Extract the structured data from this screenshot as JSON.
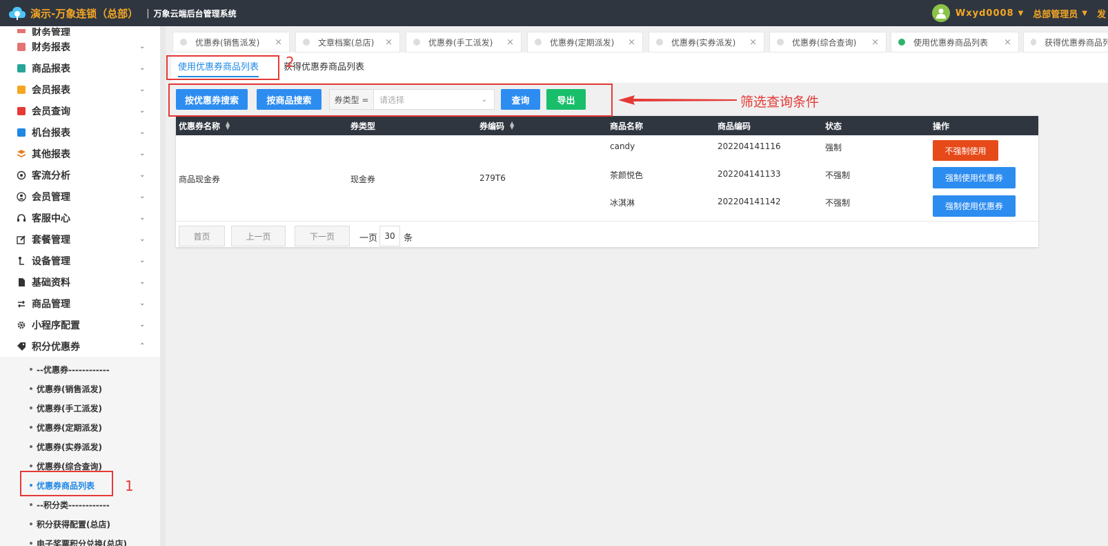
{
  "header": {
    "brand": "演示-万象连锁（总部）",
    "separator": "|",
    "system_name": "万象云端后台管理系统",
    "username": "Wxyd0008",
    "role": "总部管理员",
    "extra": "发"
  },
  "sidebar": {
    "first_partial": "财务管理",
    "items": [
      {
        "label": "财务报表",
        "icon": "finance-report-icon",
        "color": "#e57373"
      },
      {
        "label": "商品报表",
        "icon": "product-report-icon",
        "color": "#26a69a"
      },
      {
        "label": "会员报表",
        "icon": "member-report-icon",
        "color": "#f5a623"
      },
      {
        "label": "会员查询",
        "icon": "member-query-icon",
        "color": "#e53935"
      },
      {
        "label": "机台报表",
        "icon": "machine-report-icon",
        "color": "#1e88e5"
      },
      {
        "label": "其他报表",
        "icon": "layers-icon",
        "color": "#e67e22"
      },
      {
        "label": "客流分析",
        "icon": "target-icon",
        "color": "#333333"
      },
      {
        "label": "会员管理",
        "icon": "user-icon",
        "color": "#333333"
      },
      {
        "label": "客服中心",
        "icon": "headset-icon",
        "color": "#333333"
      },
      {
        "label": "套餐管理",
        "icon": "edit-icon",
        "color": "#333333"
      },
      {
        "label": "设备管理",
        "icon": "joystick-icon",
        "color": "#333333"
      },
      {
        "label": "基础资料",
        "icon": "file-icon",
        "color": "#333333"
      },
      {
        "label": "商品管理",
        "icon": "swap-icon",
        "color": "#333333"
      },
      {
        "label": "小程序配置",
        "icon": "gear-icon",
        "color": "#333333"
      },
      {
        "label": "积分优惠券",
        "icon": "tag-icon",
        "color": "#333333"
      }
    ],
    "submenu": [
      {
        "label": "--优惠券------------",
        "divider": true
      },
      {
        "label": "优惠券(销售派发)"
      },
      {
        "label": "优惠券(手工派发)"
      },
      {
        "label": "优惠券(定期派发)"
      },
      {
        "label": "优惠券(实券派发)"
      },
      {
        "label": "优惠券(综合查询)"
      },
      {
        "label": "优惠券商品列表",
        "active": true
      },
      {
        "label": "--积分类------------",
        "divider": true
      },
      {
        "label": "积分获得配置(总店)"
      },
      {
        "label": "电子奖票积分兑换(总店)"
      }
    ]
  },
  "tabs": [
    {
      "label": "优惠券(销售派发)",
      "close": "×"
    },
    {
      "label": "文章档案(总店)",
      "close": "×"
    },
    {
      "label": "优惠券(手工派发)",
      "close": "×"
    },
    {
      "label": "优惠券(定期派发)",
      "close": "×"
    },
    {
      "label": "优惠券(实券派发)",
      "close": "×"
    },
    {
      "label": "优惠券(综合查询)",
      "close": "×"
    },
    {
      "label": "使用优惠券商品列表",
      "close": "×",
      "active": true
    },
    {
      "label": "获得优惠券商品列表",
      "close": "×"
    }
  ],
  "subtabs": [
    {
      "label": "使用优惠券商品列表",
      "active": true
    },
    {
      "label": "获得优惠券商品列表",
      "active": false
    }
  ],
  "filter": {
    "search_by_coupon": "按优惠券搜索",
    "search_by_product": "按商品搜索",
    "type_prefix": "券类型 =",
    "type_placeholder": "请选择",
    "query": "查询",
    "export": "导出"
  },
  "table": {
    "columns": [
      "优惠券名称",
      "券类型",
      "券编码",
      "商品名称",
      "商品编码",
      "状态",
      "操作"
    ],
    "group": {
      "coupon_name": "商品现金券",
      "coupon_type": "现金券",
      "coupon_code": "279T6"
    },
    "rows": [
      {
        "product_name": "candy",
        "product_code": "202204141116",
        "status": "强制",
        "action": "不强制使用"
      },
      {
        "product_name": "茶颜悦色",
        "product_code": "202204141133",
        "status": "不强制",
        "action": "强制使用优惠券"
      },
      {
        "product_name": "冰淇淋",
        "product_code": "202204141142",
        "status": "不强制",
        "action": "强制使用优惠券"
      }
    ]
  },
  "pager": {
    "first": "首页",
    "prev": "上一页",
    "next": "下一页",
    "per_page_label": "一页",
    "per_page": "30",
    "unit": "条"
  },
  "annotations": {
    "num1": "1",
    "num2": "2",
    "filter_label": "筛选查询条件"
  },
  "colors": {
    "primary": "#2d8cf0",
    "success": "#19be6b",
    "danger": "#e64a19",
    "header_bg": "#2f3640",
    "brand": "#f5a623",
    "annotation": "#e53935"
  }
}
